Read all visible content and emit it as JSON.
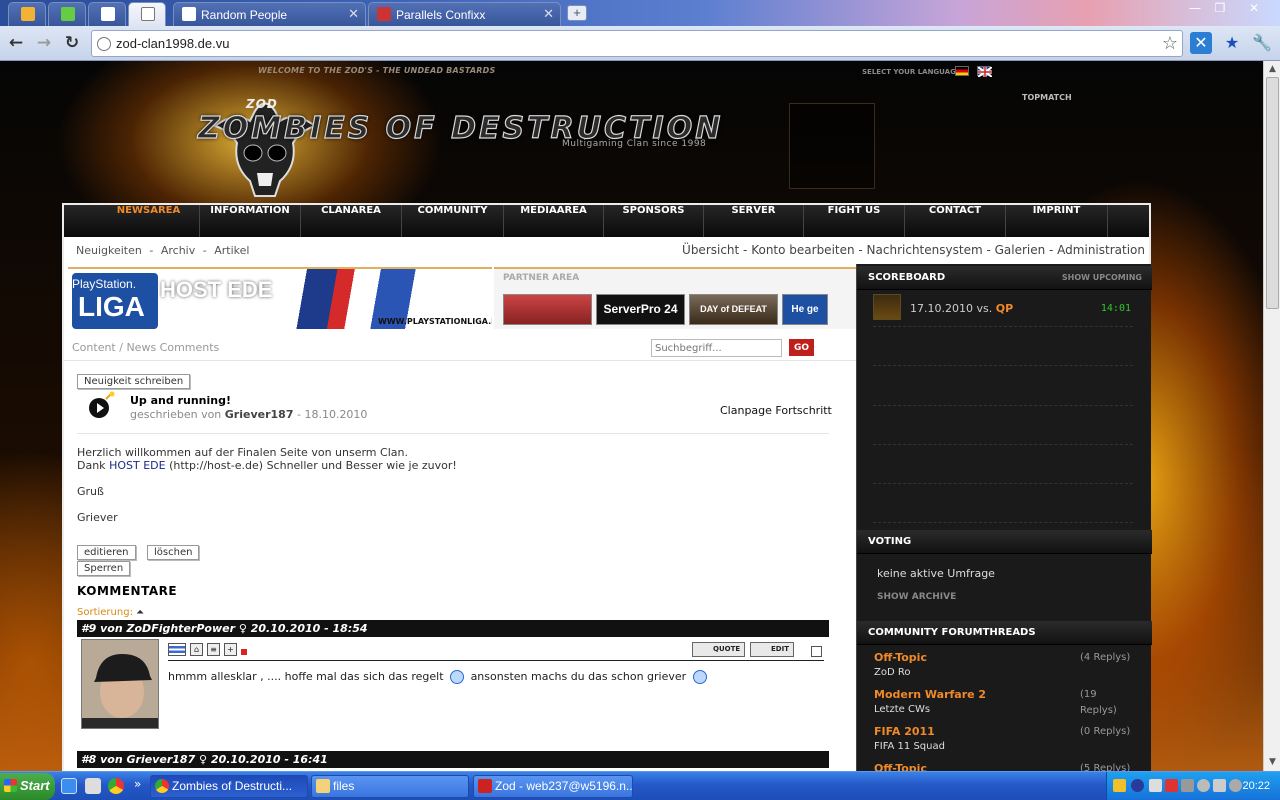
{
  "browser": {
    "tabs": [
      {
        "label": "",
        "pinned": true
      },
      {
        "label": "",
        "pinned": true
      },
      {
        "label": "",
        "pinned": true
      },
      {
        "label": "",
        "pinned": true
      },
      {
        "label": "Random People"
      },
      {
        "label": "Parallels Confixx"
      }
    ],
    "url": "zod-clan1998.de.vu"
  },
  "header": {
    "welcome": "WELCOME TO THE ZOD'S - THE UNDEAD BASTARDS",
    "select_language": "SELECT YOUR LANGUAGE",
    "logo_text": "ZOMBIES OF DESTRUCTION",
    "logo_badge": "ZOD",
    "logo_sub": "Multigaming Clan since 1998",
    "topmatch": "TOPMATCH"
  },
  "nav": {
    "items": [
      "NEWSAREA",
      "INFORMATION",
      "CLANAREA",
      "COMMUNITY",
      "MEDIAAREA",
      "SPONSORS",
      "SERVER",
      "FIGHT US",
      "CONTACT",
      "IMPRINT"
    ],
    "active": "NEWSAREA"
  },
  "subnav": {
    "left": [
      "Neuigkeiten",
      "-",
      "Archiv",
      "-",
      "Artikel"
    ],
    "right": "Übersicht - Konto bearbeiten - Nachrichtensystem - Galerien - Administration"
  },
  "banner": {
    "ps_line1": "PlayStation.",
    "ps_line2": "LIGA",
    "host": "HOST EDE",
    "url": "WWW.PLAYSTATIONLIGA.DE"
  },
  "partner": {
    "title": "PARTNER AREA",
    "items": [
      "",
      "ServerPro 24",
      "DAY of DEFEAT",
      "He ge"
    ]
  },
  "content": {
    "crumb": "Content / News Comments",
    "search_placeholder": "Suchbegriff...",
    "go": "GO",
    "write_news": "Neuigkeit schreiben",
    "news_title": "Up and running!",
    "news_meta_prefix": "geschrieben von",
    "news_author": "Griever187",
    "news_date": "- 18.10.2010",
    "news_category": "Clanpage Fortschritt",
    "body_line1": "Herzlich willkommen auf der Finalen Seite von unserm Clan.",
    "body_line2_pre": "Dank",
    "body_line2_link": "HOST EDE",
    "body_line2_post": "(http://host-e.de) Schneller und Besser wie je zuvor!",
    "body_line3": "Gruß",
    "body_line4": "Griever",
    "btn_edit": "editieren",
    "btn_delete": "löschen",
    "btn_lock": "Sperren",
    "comments_title": "KOMMENTARE",
    "sort_label": "Sortierung:",
    "comments": [
      {
        "header": "#9 von ZoDFighterPower ♀ 20.10.2010 - 18:54",
        "text_pre": "hmmm allesklar , .... hoffe mal das sich das regelt",
        "text_post": "ansonsten machs du das schon griever",
        "quote": "QUOTE",
        "edit": "EDIT"
      },
      {
        "header": "#8 von Griever187 ♀ 20.10.2010 - 16:41"
      }
    ]
  },
  "sidebar": {
    "scoreboard_title": "SCOREBOARD",
    "show_upcoming": "SHOW UPCOMING",
    "match_date": "17.10.2010",
    "match_vs": "vs.",
    "match_opponent": "QP",
    "match_time": "14:01",
    "voting_title": "VOTING",
    "voting_text": "keine aktive Umfrage",
    "voting_archive": "SHOW ARCHIVE",
    "forum_title": "COMMUNITY FORUMTHREADS",
    "threads": [
      {
        "title": "Off-Topic",
        "sub": "ZoD Ro",
        "replies": "(4 Replys)"
      },
      {
        "title": "Modern Warfare 2",
        "sub": "Letzte CWs",
        "replies": "(19 Replys)"
      },
      {
        "title": "FIFA 2011",
        "sub": "FIFA 11 Squad",
        "replies": "(0 Replys)"
      },
      {
        "title": "Off-Topic",
        "sub": "",
        "replies": "(5 Replys)"
      }
    ]
  },
  "taskbar": {
    "start": "Start",
    "items": [
      {
        "label": "Zombies of Destructi...",
        "active": true
      },
      {
        "label": "files"
      },
      {
        "label": "Zod - web237@w5196.n..."
      }
    ],
    "clock": "20:22"
  }
}
